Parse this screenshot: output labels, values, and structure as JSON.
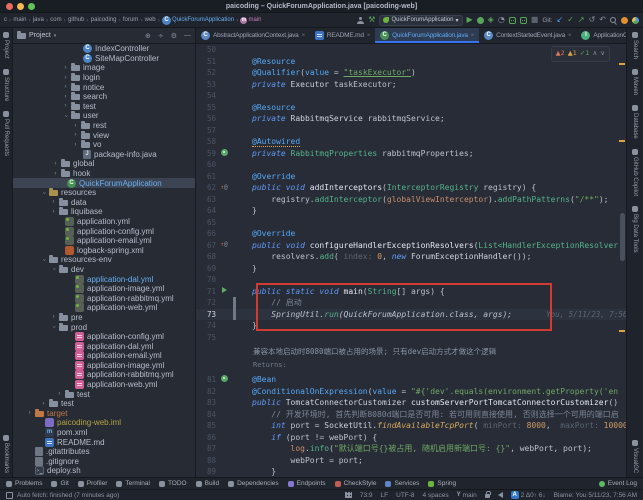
{
  "window": {
    "title": "paicoding – QuickForumApplication.java [paicoding-web]",
    "traffic_lights": [
      "#ee6a5f",
      "#f5bd4f",
      "#61c454"
    ]
  },
  "accent": "#3574f0",
  "breadcrumbs": [
    {
      "label": "c"
    },
    {
      "label": "main"
    },
    {
      "label": "java"
    },
    {
      "label": "com"
    },
    {
      "label": "github"
    },
    {
      "label": "paicoding"
    },
    {
      "label": "forum"
    },
    {
      "label": "web"
    },
    {
      "label": "QuickForumApplication",
      "icon": "class",
      "color": "#6ab0f3"
    },
    {
      "label": "main",
      "icon": "method",
      "color": "#c77dbb"
    }
  ],
  "toolbar": {
    "run_config": "QuickForumApplication",
    "git_label": "Git:"
  },
  "left_stripe": {
    "top": [
      "Project",
      "Structure",
      "Pull Requests"
    ],
    "bottom": [
      "Bookmarks"
    ]
  },
  "right_stripe": {
    "top": [
      "Search",
      "Maven",
      "Database",
      "GitHub Copilot",
      "Big Data Tools"
    ],
    "bottom": [
      "VisualGC"
    ]
  },
  "project": {
    "header": "Project",
    "tree": [
      {
        "label": "IndexController",
        "indent": 62,
        "icon": "class"
      },
      {
        "label": "SiteMapController",
        "indent": 62,
        "icon": "class"
      },
      {
        "label": "image",
        "indent": 50,
        "chevron": ">",
        "icon": "folder"
      },
      {
        "label": "login",
        "indent": 50,
        "chevron": ">",
        "icon": "folder"
      },
      {
        "label": "notice",
        "indent": 50,
        "chevron": ">",
        "icon": "folder"
      },
      {
        "label": "search",
        "indent": 50,
        "chevron": ">",
        "icon": "folder"
      },
      {
        "label": "test",
        "indent": 50,
        "chevron": ">",
        "icon": "folder"
      },
      {
        "label": "user",
        "indent": 50,
        "chevron": "v",
        "icon": "folder"
      },
      {
        "label": "rest",
        "indent": 60,
        "chevron": ">",
        "icon": "folder"
      },
      {
        "label": "view",
        "indent": 60,
        "chevron": ">",
        "icon": "folder"
      },
      {
        "label": "vo",
        "indent": 60,
        "chevron": ">",
        "icon": "folder"
      },
      {
        "label": "package-info.java",
        "indent": 62,
        "icon": "java"
      },
      {
        "label": "global",
        "indent": 40,
        "chevron": ">",
        "icon": "folder"
      },
      {
        "label": "hook",
        "indent": 40,
        "chevron": ">",
        "icon": "folder"
      },
      {
        "label": "QuickForumApplication",
        "indent": 46,
        "icon": "boot",
        "selected": true,
        "cls": "blue"
      },
      {
        "label": "resources",
        "indent": 28,
        "chevron": "v",
        "icon": "resfolder"
      },
      {
        "label": "data",
        "indent": 38,
        "chevron": ">",
        "icon": "folder"
      },
      {
        "label": "liquibase",
        "indent": 38,
        "chevron": ">",
        "icon": "folder"
      },
      {
        "label": "application.yml",
        "indent": 44,
        "icon": "ymlg"
      },
      {
        "label": "application-config.yml",
        "indent": 44,
        "icon": "ymlg"
      },
      {
        "label": "application-email.yml",
        "indent": 44,
        "icon": "ymlg"
      },
      {
        "label": "logback-spring.xml",
        "indent": 44,
        "icon": "xml"
      },
      {
        "label": "resources-env",
        "indent": 28,
        "chevron": "v",
        "icon": "folder"
      },
      {
        "label": "dev",
        "indent": 38,
        "chevron": "v",
        "icon": "folder"
      },
      {
        "label": "application-dal.yml",
        "indent": 54,
        "icon": "ymlg",
        "cls": "blue"
      },
      {
        "label": "application-image.yml",
        "indent": 54,
        "icon": "ymlg"
      },
      {
        "label": "application-rabbitmq.yml",
        "indent": 54,
        "icon": "ymlg"
      },
      {
        "label": "application-web.yml",
        "indent": 54,
        "icon": "ymlg"
      },
      {
        "label": "pre",
        "indent": 38,
        "chevron": ">",
        "icon": "folder"
      },
      {
        "label": "prod",
        "indent": 38,
        "chevron": "v",
        "icon": "folder"
      },
      {
        "label": "application-config.yml",
        "indent": 54,
        "icon": "ymlp"
      },
      {
        "label": "application-dal.yml",
        "indent": 54,
        "icon": "ymlp"
      },
      {
        "label": "application-email.yml",
        "indent": 54,
        "icon": "ymlp"
      },
      {
        "label": "application-image.yml",
        "indent": 54,
        "icon": "ymlp"
      },
      {
        "label": "application-rabbitmq.yml",
        "indent": 54,
        "icon": "ymlp"
      },
      {
        "label": "application-web.yml",
        "indent": 54,
        "icon": "ymlp"
      },
      {
        "label": "test",
        "indent": 44,
        "chevron": ">",
        "icon": "folder"
      },
      {
        "label": "test",
        "indent": 28,
        "chevron": ">",
        "icon": "folder"
      },
      {
        "label": "target",
        "indent": 14,
        "chevron": ">",
        "icon": "folder-ex",
        "cls": "orange"
      },
      {
        "label": "paicoding-web.iml",
        "indent": 24,
        "icon": "iml",
        "cls": "olive"
      },
      {
        "label": "pom.xml",
        "indent": 24,
        "icon": "pom"
      },
      {
        "label": "README.md",
        "indent": 24,
        "icon": "readme"
      },
      {
        "label": ".gitattributes",
        "indent": 14,
        "icon": "gitf"
      },
      {
        "label": ".gitignore",
        "indent": 14,
        "icon": "gitf"
      },
      {
        "label": "deploy.sh",
        "indent": 14,
        "icon": "sh"
      }
    ]
  },
  "tabs": [
    {
      "label": "AbstractApplicationContext.java",
      "icon": "classdark"
    },
    {
      "label": "README.md",
      "icon": "readme"
    },
    {
      "label": "QuickForumApplication.java",
      "icon": "boot",
      "active": true
    },
    {
      "label": "ContextStartedEvent.java",
      "icon": "classdark"
    },
    {
      "label": "ApplicationContext.java",
      "icon": "iface"
    }
  ],
  "inspections": {
    "warn1": "2",
    "warn2": "1",
    "ok": "1"
  },
  "editor": {
    "blame_inline": "You, 5/11/23, 7:56",
    "doc": {
      "text": "兼容本地启动时8080端口被占用的场景; 只有dev启动方式才做这个逻辑",
      "sub": "Returns:"
    },
    "lines": [
      {
        "n": "50",
        "tokens": []
      },
      {
        "n": "51",
        "tokens": [
          [
            "a",
            "@Resource"
          ]
        ]
      },
      {
        "n": "52",
        "tokens": [
          [
            "a",
            "@Qualifier"
          ],
          [
            "p",
            "("
          ],
          [
            "pn",
            "value"
          ],
          [
            "p",
            " = "
          ],
          [
            "su",
            "\"taskExecutor\""
          ],
          [
            "p",
            ")"
          ]
        ]
      },
      {
        "n": "53",
        "tokens": [
          [
            "k",
            "private "
          ],
          [
            "cl",
            "Executor "
          ],
          [
            "p",
            "taskExecutor;"
          ]
        ]
      },
      {
        "n": "54",
        "tokens": []
      },
      {
        "n": "55",
        "tokens": [
          [
            "a",
            "@Resource"
          ]
        ]
      },
      {
        "n": "56",
        "tokens": [
          [
            "k",
            "private "
          ],
          [
            "cl",
            "RabbitmqService "
          ],
          [
            "p",
            "rabbitmqService;"
          ]
        ]
      },
      {
        "n": "57",
        "tokens": []
      },
      {
        "n": "58",
        "tokens": [
          [
            "au",
            "@Autowired"
          ]
        ]
      },
      {
        "n": "59",
        "g": "bean",
        "tokens": [
          [
            "k",
            "private "
          ],
          [
            "t",
            "RabbitmqProperties "
          ],
          [
            "p",
            "rabbitmqProperties;"
          ]
        ]
      },
      {
        "n": "60",
        "tokens": []
      },
      {
        "n": "61",
        "tokens": [
          [
            "a",
            "@Override"
          ]
        ]
      },
      {
        "n": "62",
        "g": "ovr",
        "tokens": [
          [
            "k",
            "public void "
          ],
          [
            "m",
            "addInterceptors"
          ],
          [
            "p",
            "("
          ],
          [
            "t",
            "InterceptorRegistry "
          ],
          [
            "p",
            "registry) {"
          ]
        ]
      },
      {
        "n": "63",
        "tokens": [
          [
            "p",
            "    registry."
          ],
          [
            "mc",
            "addInterceptor"
          ],
          [
            "p",
            "("
          ],
          [
            "f",
            "globalViewInterceptor"
          ],
          [
            "p",
            ")."
          ],
          [
            "mc",
            "addPathPatterns"
          ],
          [
            "p",
            "("
          ],
          [
            "s",
            "\"/**\""
          ],
          [
            "p",
            ");"
          ]
        ]
      },
      {
        "n": "64",
        "tokens": [
          [
            "p",
            "}"
          ]
        ]
      },
      {
        "n": "65",
        "tokens": []
      },
      {
        "n": "66",
        "tokens": [
          [
            "a",
            "@Override"
          ]
        ]
      },
      {
        "n": "67",
        "g": "ovr",
        "tokens": [
          [
            "k",
            "public void "
          ],
          [
            "m",
            "configureHandlerExceptionResolvers"
          ],
          [
            "p",
            "("
          ],
          [
            "t",
            "List<HandlerExceptionResolver"
          ]
        ]
      },
      {
        "n": "68",
        "tokens": [
          [
            "p",
            "    resolvers."
          ],
          [
            "mc",
            "add"
          ],
          [
            "p",
            "( "
          ],
          [
            "h",
            "index: "
          ],
          [
            "n",
            "0"
          ],
          [
            "p",
            ", "
          ],
          [
            "k",
            "new "
          ],
          [
            "cl",
            "ForumExceptionHandler"
          ],
          [
            "p",
            "());"
          ]
        ]
      },
      {
        "n": "69",
        "tokens": [
          [
            "p",
            "}"
          ]
        ]
      },
      {
        "n": "70",
        "tokens": []
      },
      {
        "n": "71",
        "g": "run",
        "tokens": [
          [
            "k",
            "public static void "
          ],
          [
            "m",
            "main"
          ],
          [
            "p",
            "("
          ],
          [
            "t",
            "String"
          ],
          [
            "p",
            "[] args) {"
          ]
        ]
      },
      {
        "n": "72",
        "chg": true,
        "tokens": [
          [
            "c",
            "    // 启动"
          ]
        ]
      },
      {
        "n": "73",
        "chg": true,
        "cur": true,
        "em": true,
        "blame": true,
        "tokens": [
          [
            "p",
            "    SpringUtil."
          ],
          [
            "mc",
            "run"
          ],
          [
            "p",
            "(QuickForumApplication.class, args);"
          ]
        ]
      },
      {
        "n": "74",
        "tokens": [
          [
            "p",
            "}"
          ]
        ]
      },
      {
        "n": "75",
        "tokens": []
      },
      {
        "doc": true
      },
      {
        "n": "81",
        "g": "bean",
        "tokens": [
          [
            "a",
            "@Bean"
          ]
        ]
      },
      {
        "n": "82",
        "tokens": [
          [
            "a",
            "@ConditionalOnExpression"
          ],
          [
            "p",
            "("
          ],
          [
            "pn",
            "value"
          ],
          [
            "p",
            " = "
          ],
          [
            "s",
            "\"#{'dev'.equals(environment.getProperty('en"
          ]
        ]
      },
      {
        "n": "83",
        "tokens": [
          [
            "k",
            "public "
          ],
          [
            "cl",
            "TomcatConnectorCustomizer "
          ],
          [
            "m",
            "customServerPortTomcatConnectorCustomizer"
          ],
          [
            "p",
            "()"
          ]
        ]
      },
      {
        "n": "84",
        "tokens": [
          [
            "c",
            "    // 开发环境时, 首先判断8080d端口是否可用: 若可用则直接使用, 否则选择一个可用的端口启"
          ]
        ]
      },
      {
        "n": "85",
        "tokens": [
          [
            "p",
            "    "
          ],
          [
            "k",
            "int "
          ],
          [
            "p",
            "port = "
          ],
          [
            "cl",
            "SocketUtil"
          ],
          [
            "p",
            "."
          ],
          [
            "mi",
            "findAvailableTcpPort"
          ],
          [
            "p",
            "( "
          ],
          [
            "h",
            "minPort: "
          ],
          [
            "n",
            "8000"
          ],
          [
            "p",
            ",  "
          ],
          [
            "h",
            "maxPort: "
          ],
          [
            "n",
            "10000"
          ],
          [
            "p",
            ","
          ]
        ]
      },
      {
        "n": "86",
        "tokens": [
          [
            "p",
            "    "
          ],
          [
            "k",
            "if "
          ],
          [
            "p",
            "(port != webPort) {"
          ]
        ]
      },
      {
        "n": "87",
        "tokens": [
          [
            "p",
            "        "
          ],
          [
            "f",
            "log"
          ],
          [
            "p",
            "."
          ],
          [
            "mc",
            "info"
          ],
          [
            "p",
            "("
          ],
          [
            "s",
            "\"默认端口号{}被占用, 随机启用新端口号: {}\""
          ],
          [
            "p",
            ", webPort, port);"
          ]
        ]
      },
      {
        "n": "88",
        "tokens": [
          [
            "p",
            "        webPort = port;"
          ]
        ]
      },
      {
        "n": "89",
        "tokens": [
          [
            "p",
            "    }"
          ]
        ]
      }
    ]
  },
  "bottom_bar": {
    "items": [
      {
        "label": "Problems",
        "color": "#8a92a0"
      },
      {
        "label": "Git",
        "color": "#8a92a0"
      },
      {
        "label": "Profiler",
        "color": "#8a92a0"
      },
      {
        "label": "Terminal",
        "color": "#8a92a0"
      },
      {
        "label": "TODO",
        "color": "#8a92a0"
      },
      {
        "label": "Build",
        "color": "#8a92a0"
      },
      {
        "label": "Dependencies",
        "color": "#8a92a0"
      },
      {
        "label": "Endpoints",
        "color": "#8577d1"
      },
      {
        "label": "CheckStyle",
        "color": "#c05d55"
      },
      {
        "label": "Services",
        "color": "#5f87c7"
      },
      {
        "label": "Spring",
        "color": "#6db33f"
      }
    ],
    "event_log": "Event Log",
    "event_log_color": "#5fb865"
  },
  "status_bar": {
    "left": "Auto fetch: finished (7 minutes ago)",
    "items": [
      {
        "icon": "grid"
      },
      {
        "label": "73:9"
      },
      {
        "label": "LF"
      },
      {
        "label": "UTF-8"
      },
      {
        "label": "4 spaces"
      },
      {
        "icon": "branch",
        "label": "main"
      },
      {
        "icon": "lock"
      },
      {
        "icon": "bell"
      },
      {
        "icon": "abadge",
        "label": "2 Δ0↑ 6↓"
      },
      {
        "label": "Blame: You 5/11/23, 7:56 AM"
      }
    ]
  }
}
